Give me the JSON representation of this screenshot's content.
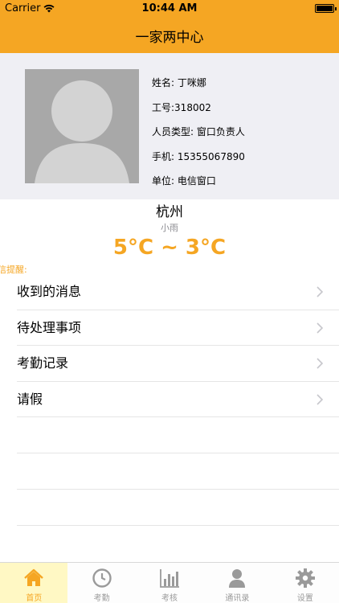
{
  "status_bar": {
    "carrier": "Carrier",
    "time": "10:44 AM"
  },
  "header": {
    "title": "一家两中心"
  },
  "profile": {
    "name_label": "姓名:",
    "name": "丁咪娜",
    "id_label": "工号:",
    "id": "318002",
    "type_label": "人员类型:",
    "type": "窗口负责人",
    "phone_label": "手机:",
    "phone": "15355067890",
    "unit_label": "单位:",
    "unit": "电信窗口"
  },
  "weather": {
    "city": "杭州",
    "condition": "小雨",
    "temperature": "5°C ~ 3°C"
  },
  "reminder_label": "信提醒:",
  "menu": [
    {
      "label": "收到的消息"
    },
    {
      "label": "待处理事项"
    },
    {
      "label": "考勤记录"
    },
    {
      "label": "请假"
    }
  ],
  "tabs": [
    {
      "label": "首页",
      "icon": "home-icon",
      "active": true
    },
    {
      "label": "考勤",
      "icon": "clock-icon",
      "active": false
    },
    {
      "label": "考核",
      "icon": "bar-chart-icon",
      "active": false
    },
    {
      "label": "通讯录",
      "icon": "person-icon",
      "active": false
    },
    {
      "label": "设置",
      "icon": "gear-icon",
      "active": false
    }
  ],
  "colors": {
    "accent": "#f5a623",
    "tab_active_bg": "#fff8c4",
    "profile_bg": "#efeff4"
  }
}
